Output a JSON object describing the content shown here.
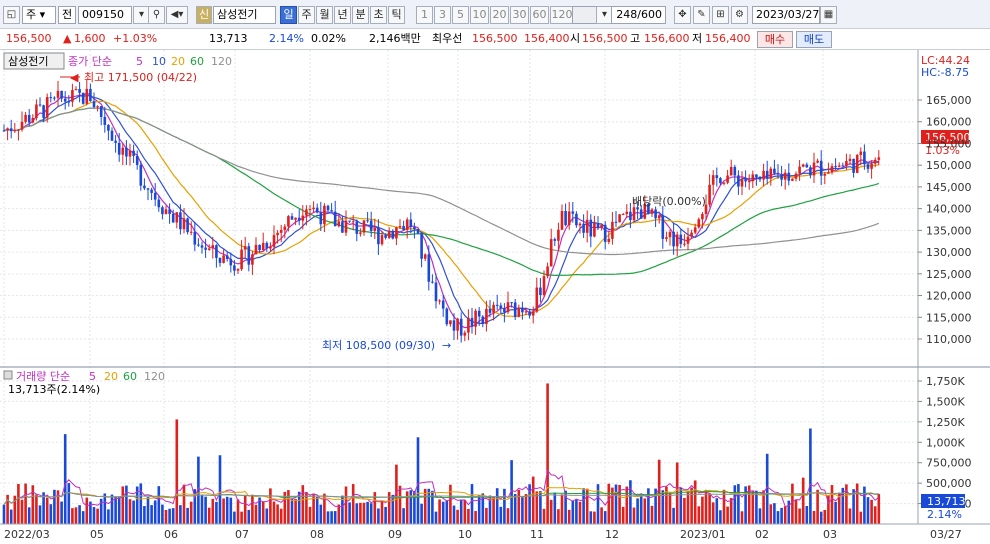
{
  "toolbar": {
    "market_select": "주",
    "prev_label": "전",
    "code_value": "009150",
    "credit_badge": "신",
    "stock_name": "삼성전기",
    "periods": [
      "일",
      "주",
      "월",
      "년",
      "분",
      "초",
      "틱"
    ],
    "selected_period": "일",
    "minute_options": [
      "1",
      "3",
      "5",
      "10",
      "20",
      "30",
      "60",
      "120"
    ],
    "count_value": "248",
    "count_total": "/600",
    "date_value": "2023/03/27"
  },
  "quote": {
    "price": "156,500",
    "change": "1,600",
    "rate": "+1.03%",
    "volume": "13,713",
    "vol_rate": "2.14%",
    "turnover": "0.02%",
    "amount": "2,146백만",
    "best_label": "최우선",
    "best_ask": "156,500",
    "best_bid": "156,400",
    "open_label": "시",
    "open": "156,500",
    "high_label": "고",
    "high": "156,600",
    "low_label": "저",
    "low": "156,400",
    "buy_label": "매수",
    "sell_label": "매도"
  },
  "price_panel": {
    "stock_label": "삼성전기",
    "legend_close": "종가 단순",
    "legend_periods": [
      "5",
      "10",
      "20",
      "60",
      "120"
    ],
    "high_annotation": "최고 171,500 (04/22)",
    "low_annotation": "최저 108,500 (09/30)",
    "event_annotation": "배당락(0.00%)",
    "lc_label": "LC:44.24",
    "hc_label": "HC:-8.75",
    "current_price_tag": "156,500",
    "current_rate_tag": "1.03%",
    "y_ticks": [
      "165,000",
      "160,000",
      "155,000",
      "150,000",
      "145,000",
      "140,000",
      "135,000",
      "130,000",
      "125,000",
      "120,000",
      "115,000",
      "110,000"
    ]
  },
  "volume_panel": {
    "legend_label": "거래량 단순",
    "legend_periods": [
      "5",
      "20",
      "60",
      "120"
    ],
    "current_volume": "13,713주(2.14%)",
    "y_ticks": [
      "1,750K",
      "1,500K",
      "1,250K",
      "1,000K",
      "750,000",
      "500,000",
      "250,000"
    ],
    "current_tag": "13,713",
    "current_rate_tag": "2.14%"
  },
  "x_axis": {
    "labels": [
      "2022/03",
      "05",
      "06",
      "07",
      "08",
      "09",
      "10",
      "11",
      "12",
      "2023/01",
      "02",
      "03"
    ],
    "right_label": "03/27"
  },
  "colors": {
    "up": "#e0201c",
    "down": "#1a49d8",
    "ma5": "#c030c0",
    "ma10": "#3050d0",
    "ma20": "#e8a000",
    "ma60": "#20a040",
    "ma120": "#909090"
  },
  "chart_data": {
    "type": "candlestick",
    "price_series_keypoints": [
      {
        "x": "2022/03",
        "close": 158000
      },
      {
        "x": "2022/04/22",
        "close": 167000,
        "high": 171500
      },
      {
        "x": "05",
        "close": 152000
      },
      {
        "x": "06",
        "close": 140000
      },
      {
        "x": "06 end",
        "close": 127000
      },
      {
        "x": "07",
        "close": 133000
      },
      {
        "x": "08",
        "close": 141000
      },
      {
        "x": "09",
        "close": 136000
      },
      {
        "x": "09/30",
        "close": 111000,
        "low": 108500
      },
      {
        "x": "10",
        "close": 117000
      },
      {
        "x": "11",
        "close": 140000
      },
      {
        "x": "12",
        "close": 136000
      },
      {
        "x": "2023/01",
        "close": 149000
      },
      {
        "x": "02",
        "close": 148000
      },
      {
        "x": "03/27",
        "close": 156500
      }
    ],
    "volume_unit": "shares",
    "last_volume": 13713
  }
}
